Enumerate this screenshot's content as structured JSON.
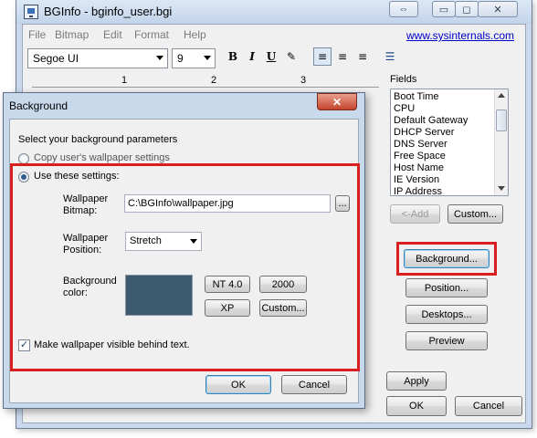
{
  "window": {
    "title": "BGInfo - bginfo_user.bgi",
    "caption_restore_glyph": "⇔",
    "caption_minimize_glyph": "▭",
    "caption_maximize_glyph": "◻",
    "caption_close_glyph": "✕"
  },
  "menu": {
    "items": [
      "File",
      "Bitmap",
      "Edit",
      "Format",
      "Help"
    ],
    "link": "www.sysinternals.com"
  },
  "toolbar": {
    "font": "Segoe UI",
    "size": "9",
    "bold": "B",
    "italic": "I",
    "underline": "U",
    "highlight_glyph": "✎",
    "align_left_glyph": "≡",
    "align_center_glyph": "≡",
    "align_right_glyph": "≡",
    "bullets_glyph": "☰"
  },
  "ruler": {
    "marks": [
      "1",
      "2",
      "3"
    ]
  },
  "fields": {
    "label": "Fields",
    "items": [
      "Boot Time",
      "CPU",
      "Default Gateway",
      "DHCP Server",
      "DNS Server",
      "Free Space",
      "Host Name",
      "IE Version",
      "IP Address"
    ],
    "add_button": "<-Add",
    "custom_button": "Custom..."
  },
  "side_buttons": {
    "background": "Background...",
    "position": "Position...",
    "desktops": "Desktops...",
    "preview": "Preview",
    "apply": "Apply",
    "ok": "OK",
    "cancel": "Cancel"
  },
  "dialog": {
    "title": "Background",
    "close_glyph": "✕",
    "intro": "Select your background parameters",
    "copy_option": "Copy user's wallpaper settings",
    "use_option": "Use these settings:",
    "wallpaper_bitmap_label_1": "Wallpaper",
    "wallpaper_bitmap_label_2": "Bitmap:",
    "wallpaper_path": "C:\\BGInfo\\wallpaper.jpg",
    "browse": "...",
    "position_label_1": "Wallpaper",
    "position_label_2": "Position:",
    "position_value": "Stretch",
    "color_label_1": "Background",
    "color_label_2": "color:",
    "swatch_color": "#3d5a6f",
    "nt40": "NT 4.0",
    "y2000": "2000",
    "xp": "XP",
    "custom": "Custom...",
    "visible_behind_text": "Make wallpaper visible behind text.",
    "visible_checked": true,
    "ok": "OK",
    "cancel": "Cancel"
  },
  "colors": {
    "highlight": "#d81e1e",
    "link": "#0000cc",
    "chrome": "#c9d8eb"
  }
}
